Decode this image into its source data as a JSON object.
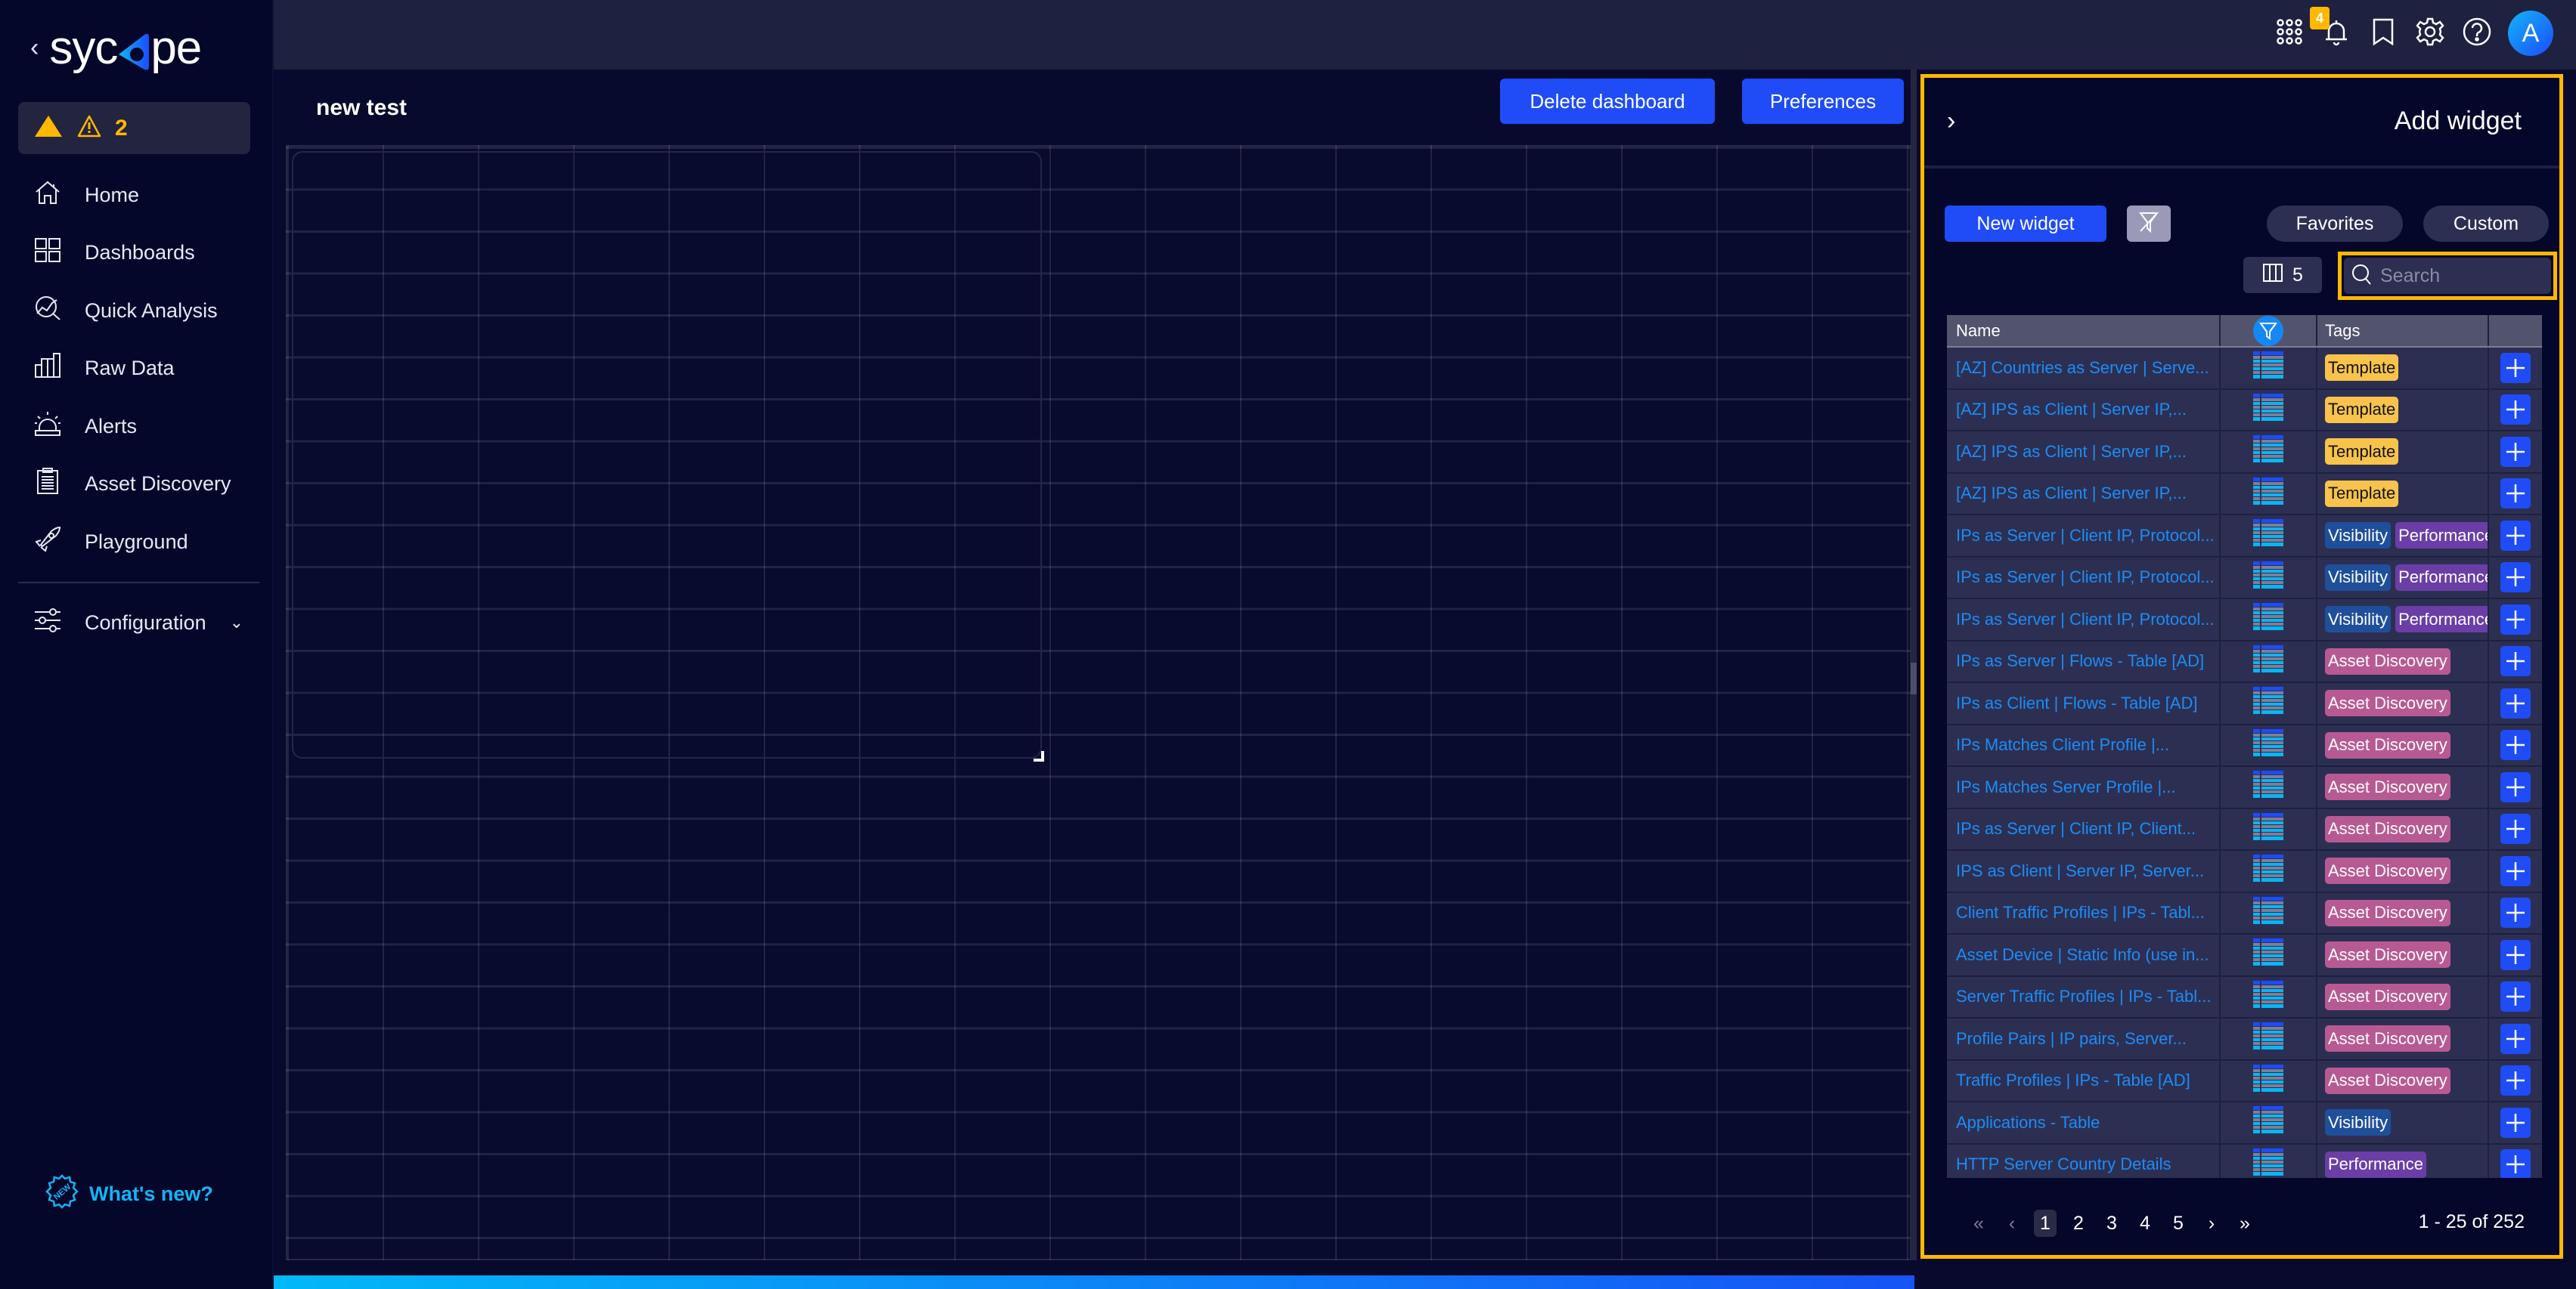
{
  "app": {
    "brand": "sycope",
    "alert_count": "2",
    "notification_count": "4",
    "avatar_initial": "A"
  },
  "sidebar": {
    "items": [
      {
        "label": "Home",
        "icon": "home-icon"
      },
      {
        "label": "Dashboards",
        "icon": "dashboards-icon"
      },
      {
        "label": "Quick Analysis",
        "icon": "quick-analysis-icon"
      },
      {
        "label": "Raw Data",
        "icon": "bar-chart-icon"
      },
      {
        "label": "Alerts",
        "icon": "siren-icon"
      },
      {
        "label": "Asset Discovery",
        "icon": "clipboard-icon"
      },
      {
        "label": "Playground",
        "icon": "rocket-icon"
      }
    ],
    "configuration": {
      "label": "Configuration",
      "icon": "sliders-icon"
    },
    "whats_new": "What's new?"
  },
  "dashboard": {
    "title": "new test",
    "delete_label": "Delete dashboard",
    "preferences_label": "Preferences"
  },
  "panel": {
    "title": "Add widget",
    "new_widget_label": "New widget",
    "favorites_label": "Favorites",
    "custom_label": "Custom",
    "columns_count": "5",
    "search_placeholder": "Search",
    "columns": {
      "name": "Name",
      "tags": "Tags"
    },
    "rows": [
      {
        "name": "[AZ] Countries as Server | Serve...",
        "tags": [
          {
            "label": "Template",
            "kind": "template"
          }
        ]
      },
      {
        "name": "[AZ] IPS as Client | Server IP,...",
        "tags": [
          {
            "label": "Template",
            "kind": "template"
          }
        ]
      },
      {
        "name": "[AZ] IPS as Client | Server IP,...",
        "tags": [
          {
            "label": "Template",
            "kind": "template"
          }
        ]
      },
      {
        "name": "[AZ] IPS as Client | Server IP,...",
        "tags": [
          {
            "label": "Template",
            "kind": "template"
          }
        ]
      },
      {
        "name": "IPs as Server | Client IP, Protocol...",
        "tags": [
          {
            "label": "Visibility",
            "kind": "visibility"
          },
          {
            "label": "Performance",
            "kind": "performance"
          }
        ]
      },
      {
        "name": "IPs as Server | Client IP, Protocol...",
        "tags": [
          {
            "label": "Visibility",
            "kind": "visibility"
          },
          {
            "label": "Performance",
            "kind": "performance"
          }
        ]
      },
      {
        "name": "IPs as Server | Client IP, Protocol...",
        "tags": [
          {
            "label": "Visibility",
            "kind": "visibility"
          },
          {
            "label": "Performance",
            "kind": "performance"
          }
        ]
      },
      {
        "name": "IPs as Server | Flows - Table [AD]",
        "tags": [
          {
            "label": "Asset Discovery",
            "kind": "asset"
          }
        ]
      },
      {
        "name": "IPs as Client | Flows - Table [AD]",
        "tags": [
          {
            "label": "Asset Discovery",
            "kind": "asset"
          }
        ]
      },
      {
        "name": "IPs Matches Client Profile |...",
        "tags": [
          {
            "label": "Asset Discovery",
            "kind": "asset"
          }
        ]
      },
      {
        "name": "IPs Matches Server Profile |...",
        "tags": [
          {
            "label": "Asset Discovery",
            "kind": "asset"
          }
        ]
      },
      {
        "name": "IPs as Server | Client IP, Client...",
        "tags": [
          {
            "label": "Asset Discovery",
            "kind": "asset"
          }
        ]
      },
      {
        "name": "IPS as Client | Server IP, Server...",
        "tags": [
          {
            "label": "Asset Discovery",
            "kind": "asset"
          }
        ]
      },
      {
        "name": "Client Traffic Profiles | IPs - Tabl...",
        "tags": [
          {
            "label": "Asset Discovery",
            "kind": "asset"
          }
        ]
      },
      {
        "name": "Asset Device | Static Info (use in...",
        "tags": [
          {
            "label": "Asset Discovery",
            "kind": "asset"
          }
        ]
      },
      {
        "name": "Server Traffic Profiles | IPs - Tabl...",
        "tags": [
          {
            "label": "Asset Discovery",
            "kind": "asset"
          }
        ]
      },
      {
        "name": "Profile Pairs | IP pairs, Server...",
        "tags": [
          {
            "label": "Asset Discovery",
            "kind": "asset"
          }
        ]
      },
      {
        "name": "Traffic Profiles | IPs - Table [AD]",
        "tags": [
          {
            "label": "Asset Discovery",
            "kind": "asset"
          }
        ]
      },
      {
        "name": "Applications - Table",
        "tags": [
          {
            "label": "Visibility",
            "kind": "visibility"
          }
        ]
      },
      {
        "name": "HTTP Server Country Details",
        "tags": [
          {
            "label": "Performance",
            "kind": "performance"
          }
        ]
      },
      {
        "name": "",
        "tags": []
      }
    ],
    "pagination": {
      "pages": [
        "1",
        "2",
        "3",
        "4",
        "5"
      ],
      "current": "1",
      "range_label": "1 - 25 of 252"
    }
  }
}
